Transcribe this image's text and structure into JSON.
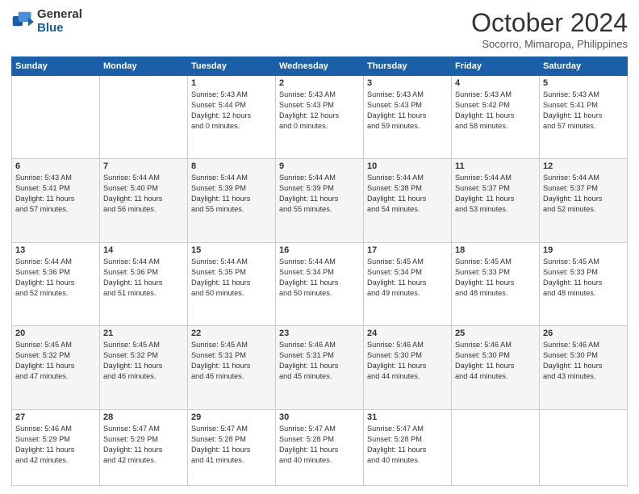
{
  "header": {
    "logo_general": "General",
    "logo_blue": "Blue",
    "month_title": "October 2024",
    "subtitle": "Socorro, Mimaropa, Philippines"
  },
  "days_of_week": [
    "Sunday",
    "Monday",
    "Tuesday",
    "Wednesday",
    "Thursday",
    "Friday",
    "Saturday"
  ],
  "weeks": [
    {
      "shade": "white",
      "days": [
        {
          "num": "",
          "info": ""
        },
        {
          "num": "",
          "info": ""
        },
        {
          "num": "1",
          "info": "Sunrise: 5:43 AM\nSunset: 5:44 PM\nDaylight: 12 hours\nand 0 minutes."
        },
        {
          "num": "2",
          "info": "Sunrise: 5:43 AM\nSunset: 5:43 PM\nDaylight: 12 hours\nand 0 minutes."
        },
        {
          "num": "3",
          "info": "Sunrise: 5:43 AM\nSunset: 5:43 PM\nDaylight: 11 hours\nand 59 minutes."
        },
        {
          "num": "4",
          "info": "Sunrise: 5:43 AM\nSunset: 5:42 PM\nDaylight: 11 hours\nand 58 minutes."
        },
        {
          "num": "5",
          "info": "Sunrise: 5:43 AM\nSunset: 5:41 PM\nDaylight: 11 hours\nand 57 minutes."
        }
      ]
    },
    {
      "shade": "shade",
      "days": [
        {
          "num": "6",
          "info": "Sunrise: 5:43 AM\nSunset: 5:41 PM\nDaylight: 11 hours\nand 57 minutes."
        },
        {
          "num": "7",
          "info": "Sunrise: 5:44 AM\nSunset: 5:40 PM\nDaylight: 11 hours\nand 56 minutes."
        },
        {
          "num": "8",
          "info": "Sunrise: 5:44 AM\nSunset: 5:39 PM\nDaylight: 11 hours\nand 55 minutes."
        },
        {
          "num": "9",
          "info": "Sunrise: 5:44 AM\nSunset: 5:39 PM\nDaylight: 11 hours\nand 55 minutes."
        },
        {
          "num": "10",
          "info": "Sunrise: 5:44 AM\nSunset: 5:38 PM\nDaylight: 11 hours\nand 54 minutes."
        },
        {
          "num": "11",
          "info": "Sunrise: 5:44 AM\nSunset: 5:37 PM\nDaylight: 11 hours\nand 53 minutes."
        },
        {
          "num": "12",
          "info": "Sunrise: 5:44 AM\nSunset: 5:37 PM\nDaylight: 11 hours\nand 52 minutes."
        }
      ]
    },
    {
      "shade": "white",
      "days": [
        {
          "num": "13",
          "info": "Sunrise: 5:44 AM\nSunset: 5:36 PM\nDaylight: 11 hours\nand 52 minutes."
        },
        {
          "num": "14",
          "info": "Sunrise: 5:44 AM\nSunset: 5:36 PM\nDaylight: 11 hours\nand 51 minutes."
        },
        {
          "num": "15",
          "info": "Sunrise: 5:44 AM\nSunset: 5:35 PM\nDaylight: 11 hours\nand 50 minutes."
        },
        {
          "num": "16",
          "info": "Sunrise: 5:44 AM\nSunset: 5:34 PM\nDaylight: 11 hours\nand 50 minutes."
        },
        {
          "num": "17",
          "info": "Sunrise: 5:45 AM\nSunset: 5:34 PM\nDaylight: 11 hours\nand 49 minutes."
        },
        {
          "num": "18",
          "info": "Sunrise: 5:45 AM\nSunset: 5:33 PM\nDaylight: 11 hours\nand 48 minutes."
        },
        {
          "num": "19",
          "info": "Sunrise: 5:45 AM\nSunset: 5:33 PM\nDaylight: 11 hours\nand 48 minutes."
        }
      ]
    },
    {
      "shade": "shade",
      "days": [
        {
          "num": "20",
          "info": "Sunrise: 5:45 AM\nSunset: 5:32 PM\nDaylight: 11 hours\nand 47 minutes."
        },
        {
          "num": "21",
          "info": "Sunrise: 5:45 AM\nSunset: 5:32 PM\nDaylight: 11 hours\nand 46 minutes."
        },
        {
          "num": "22",
          "info": "Sunrise: 5:45 AM\nSunset: 5:31 PM\nDaylight: 11 hours\nand 46 minutes."
        },
        {
          "num": "23",
          "info": "Sunrise: 5:46 AM\nSunset: 5:31 PM\nDaylight: 11 hours\nand 45 minutes."
        },
        {
          "num": "24",
          "info": "Sunrise: 5:46 AM\nSunset: 5:30 PM\nDaylight: 11 hours\nand 44 minutes."
        },
        {
          "num": "25",
          "info": "Sunrise: 5:46 AM\nSunset: 5:30 PM\nDaylight: 11 hours\nand 44 minutes."
        },
        {
          "num": "26",
          "info": "Sunrise: 5:46 AM\nSunset: 5:30 PM\nDaylight: 11 hours\nand 43 minutes."
        }
      ]
    },
    {
      "shade": "white",
      "days": [
        {
          "num": "27",
          "info": "Sunrise: 5:46 AM\nSunset: 5:29 PM\nDaylight: 11 hours\nand 42 minutes."
        },
        {
          "num": "28",
          "info": "Sunrise: 5:47 AM\nSunset: 5:29 PM\nDaylight: 11 hours\nand 42 minutes."
        },
        {
          "num": "29",
          "info": "Sunrise: 5:47 AM\nSunset: 5:28 PM\nDaylight: 11 hours\nand 41 minutes."
        },
        {
          "num": "30",
          "info": "Sunrise: 5:47 AM\nSunset: 5:28 PM\nDaylight: 11 hours\nand 40 minutes."
        },
        {
          "num": "31",
          "info": "Sunrise: 5:47 AM\nSunset: 5:28 PM\nDaylight: 11 hours\nand 40 minutes."
        },
        {
          "num": "",
          "info": ""
        },
        {
          "num": "",
          "info": ""
        }
      ]
    }
  ]
}
